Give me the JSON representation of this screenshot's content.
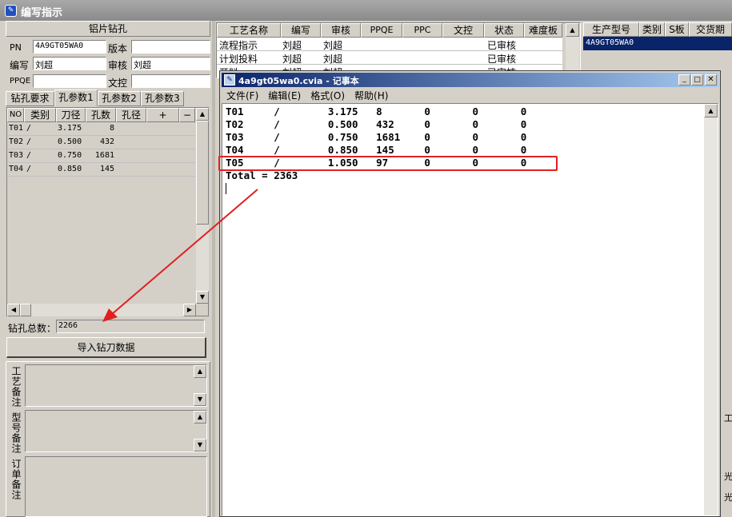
{
  "title_bar": {
    "title": "编写指示"
  },
  "left_panel": {
    "section_title": "铝片钻孔",
    "fields": {
      "pn_label": "PN",
      "pn_value": "4A9GT05WA0",
      "version_label": "版本",
      "version_value": "",
      "author_label": "编写",
      "author_value": "刘超",
      "review_label": "审核",
      "review_value": "刘超",
      "ppqe_label": "PPQE",
      "ppqe_value": "",
      "doc_label": "文控",
      "doc_value": ""
    },
    "tabs": [
      "钻孔要求",
      "孔参数1",
      "孔参数2",
      "孔参数3"
    ],
    "grid": {
      "headers": [
        "NO",
        "类别",
        "刀径",
        "孔数",
        "孔径",
        "+",
        "−"
      ],
      "rows": [
        {
          "no": "T01",
          "type": "/",
          "dia": "3.175",
          "count": "8"
        },
        {
          "no": "T02",
          "type": "/",
          "dia": "0.500",
          "count": "432"
        },
        {
          "no": "T03",
          "type": "/",
          "dia": "0.750",
          "count": "1681"
        },
        {
          "no": "T04",
          "type": "/",
          "dia": "0.850",
          "count": "145"
        }
      ]
    },
    "total_label": "钻孔总数：",
    "total_value": "2266",
    "import_button": "导入钻刀数据",
    "notes": {
      "process": "工艺备注",
      "model": "型号备注",
      "order": "订单备注"
    }
  },
  "process_table": {
    "headers": [
      "工艺名称",
      "编写",
      "审核",
      "PPQE",
      "PPC",
      "文控",
      "状态",
      "难度板"
    ],
    "rows": [
      {
        "name": "流程指示",
        "author": "刘超",
        "review": "刘超",
        "status": "已审核"
      },
      {
        "name": "计划投料",
        "author": "刘超",
        "review": "刘超",
        "status": "已审核"
      },
      {
        "name": "开料",
        "author": "刘超",
        "review": "刘超",
        "status": "已审核"
      }
    ]
  },
  "prod_table": {
    "headers": [
      "生产型号",
      "类别",
      "S板",
      "交货期"
    ],
    "rows": [
      {
        "model": "4A9GT05WA0",
        "type": "",
        "s": "",
        "date": ""
      }
    ]
  },
  "notepad": {
    "title": "4a9gt05wa0.cvia - 记事本",
    "menu": [
      "文件(F)",
      "编辑(E)",
      "格式(O)",
      "帮助(H)"
    ],
    "lines": [
      "T01     /        3.175   8       0       0       0",
      "T02     /        0.500   432     0       0       0",
      "T03     /        0.750   1681    0       0       0",
      "T04     /        0.850   145     0       0       0",
      "T05     /        1.050   97      0       0       0",
      "Total = 2363"
    ]
  },
  "right_edge_glyphs": [
    "工",
    "光",
    "光"
  ],
  "colors": {
    "highlight": "#e02020",
    "selection": "#0a246a",
    "face": "#d4d0c8"
  }
}
